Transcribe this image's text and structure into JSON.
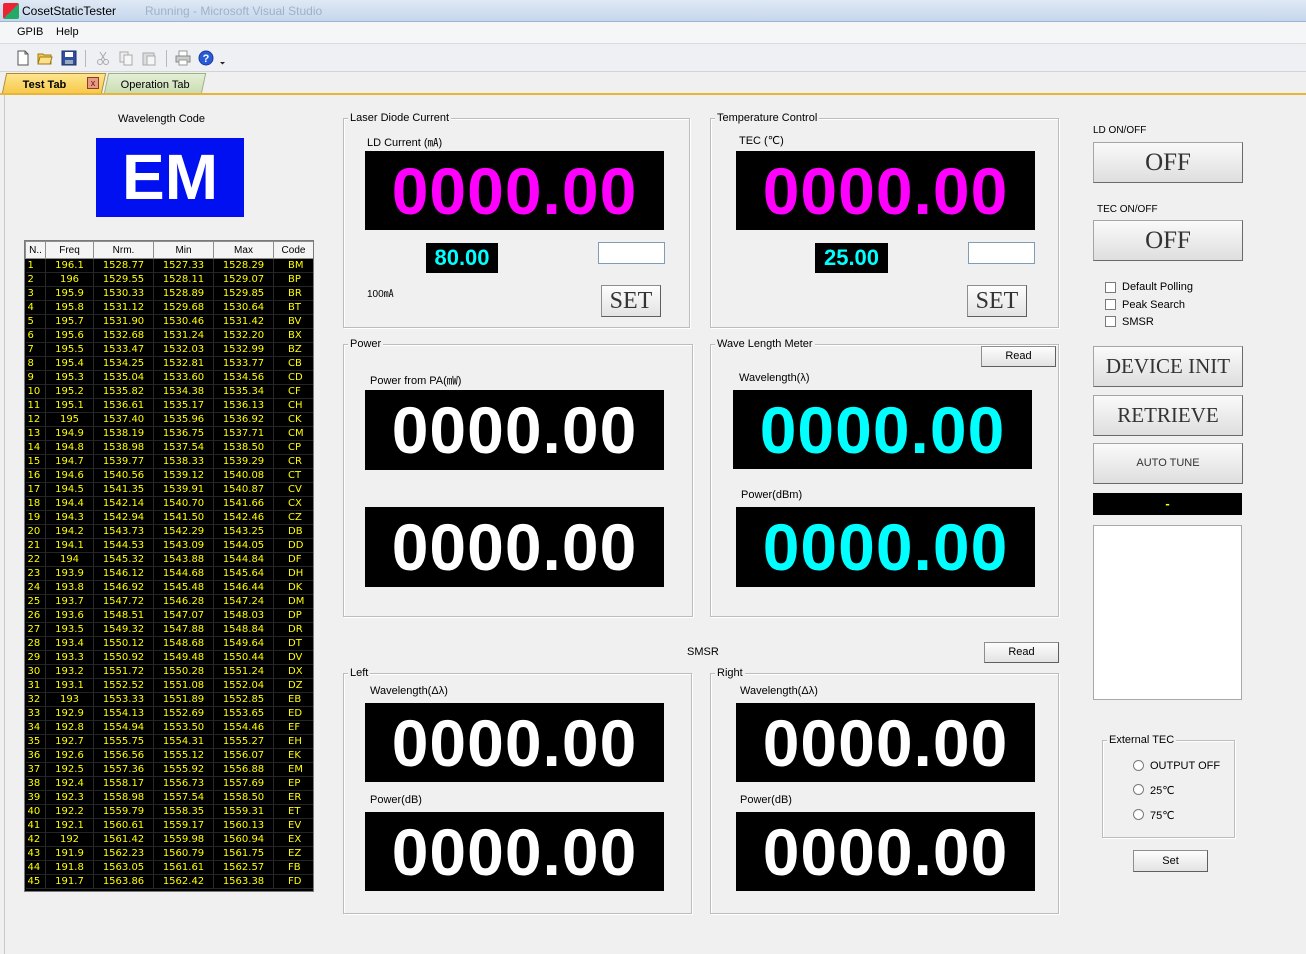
{
  "window": {
    "title": "CosetStaticTester",
    "background_title": "Running - Microsoft Visual Studio"
  },
  "menu": {
    "items": [
      "GPIB",
      "Help"
    ]
  },
  "toolbar": {
    "icons": [
      "new-icon",
      "open-icon",
      "save-icon",
      "cut-icon",
      "copy-icon",
      "paste-icon",
      "print-icon",
      "help-icon"
    ]
  },
  "tabs": {
    "test": "Test Tab",
    "close": "x",
    "operation": "Operation Tab"
  },
  "wavelength_code": {
    "label": "Wavelength Code",
    "value": "EM"
  },
  "code_table": {
    "headers": [
      "N..",
      "Freq",
      "Nrm.",
      "Min",
      "Max",
      "Code"
    ],
    "rows": [
      [
        "1",
        "196.1",
        "1528.77",
        "1527.33",
        "1528.29",
        "BM"
      ],
      [
        "2",
        "196",
        "1529.55",
        "1528.11",
        "1529.07",
        "BP"
      ],
      [
        "3",
        "195.9",
        "1530.33",
        "1528.89",
        "1529.85",
        "BR"
      ],
      [
        "4",
        "195.8",
        "1531.12",
        "1529.68",
        "1530.64",
        "BT"
      ],
      [
        "5",
        "195.7",
        "1531.90",
        "1530.46",
        "1531.42",
        "BV"
      ],
      [
        "6",
        "195.6",
        "1532.68",
        "1531.24",
        "1532.20",
        "BX"
      ],
      [
        "7",
        "195.5",
        "1533.47",
        "1532.03",
        "1532.99",
        "BZ"
      ],
      [
        "8",
        "195.4",
        "1534.25",
        "1532.81",
        "1533.77",
        "CB"
      ],
      [
        "9",
        "195.3",
        "1535.04",
        "1533.60",
        "1534.56",
        "CD"
      ],
      [
        "10",
        "195.2",
        "1535.82",
        "1534.38",
        "1535.34",
        "CF"
      ],
      [
        "11",
        "195.1",
        "1536.61",
        "1535.17",
        "1536.13",
        "CH"
      ],
      [
        "12",
        "195",
        "1537.40",
        "1535.96",
        "1536.92",
        "CK"
      ],
      [
        "13",
        "194.9",
        "1538.19",
        "1536.75",
        "1537.71",
        "CM"
      ],
      [
        "14",
        "194.8",
        "1538.98",
        "1537.54",
        "1538.50",
        "CP"
      ],
      [
        "15",
        "194.7",
        "1539.77",
        "1538.33",
        "1539.29",
        "CR"
      ],
      [
        "16",
        "194.6",
        "1540.56",
        "1539.12",
        "1540.08",
        "CT"
      ],
      [
        "17",
        "194.5",
        "1541.35",
        "1539.91",
        "1540.87",
        "CV"
      ],
      [
        "18",
        "194.4",
        "1542.14",
        "1540.70",
        "1541.66",
        "CX"
      ],
      [
        "19",
        "194.3",
        "1542.94",
        "1541.50",
        "1542.46",
        "CZ"
      ],
      [
        "20",
        "194.2",
        "1543.73",
        "1542.29",
        "1543.25",
        "DB"
      ],
      [
        "21",
        "194.1",
        "1544.53",
        "1543.09",
        "1544.05",
        "DD"
      ],
      [
        "22",
        "194",
        "1545.32",
        "1543.88",
        "1544.84",
        "DF"
      ],
      [
        "23",
        "193.9",
        "1546.12",
        "1544.68",
        "1545.64",
        "DH"
      ],
      [
        "24",
        "193.8",
        "1546.92",
        "1545.48",
        "1546.44",
        "DK"
      ],
      [
        "25",
        "193.7",
        "1547.72",
        "1546.28",
        "1547.24",
        "DM"
      ],
      [
        "26",
        "193.6",
        "1548.51",
        "1547.07",
        "1548.03",
        "DP"
      ],
      [
        "27",
        "193.5",
        "1549.32",
        "1547.88",
        "1548.84",
        "DR"
      ],
      [
        "28",
        "193.4",
        "1550.12",
        "1548.68",
        "1549.64",
        "DT"
      ],
      [
        "29",
        "193.3",
        "1550.92",
        "1549.48",
        "1550.44",
        "DV"
      ],
      [
        "30",
        "193.2",
        "1551.72",
        "1550.28",
        "1551.24",
        "DX"
      ],
      [
        "31",
        "193.1",
        "1552.52",
        "1551.08",
        "1552.04",
        "DZ"
      ],
      [
        "32",
        "193",
        "1553.33",
        "1551.89",
        "1552.85",
        "EB"
      ],
      [
        "33",
        "192.9",
        "1554.13",
        "1552.69",
        "1553.65",
        "ED"
      ],
      [
        "34",
        "192.8",
        "1554.94",
        "1553.50",
        "1554.46",
        "EF"
      ],
      [
        "35",
        "192.7",
        "1555.75",
        "1554.31",
        "1555.27",
        "EH"
      ],
      [
        "36",
        "192.6",
        "1556.56",
        "1555.12",
        "1556.07",
        "EK"
      ],
      [
        "37",
        "192.5",
        "1557.36",
        "1555.92",
        "1556.88",
        "EM"
      ],
      [
        "38",
        "192.4",
        "1558.17",
        "1556.73",
        "1557.69",
        "EP"
      ],
      [
        "39",
        "192.3",
        "1558.98",
        "1557.54",
        "1558.50",
        "ER"
      ],
      [
        "40",
        "192.2",
        "1559.79",
        "1558.35",
        "1559.31",
        "ET"
      ],
      [
        "41",
        "192.1",
        "1560.61",
        "1559.17",
        "1560.13",
        "EV"
      ],
      [
        "42",
        "192",
        "1561.42",
        "1559.98",
        "1560.94",
        "EX"
      ],
      [
        "43",
        "191.9",
        "1562.23",
        "1560.79",
        "1561.75",
        "EZ"
      ],
      [
        "44",
        "191.8",
        "1563.05",
        "1561.61",
        "1562.57",
        "FB"
      ],
      [
        "45",
        "191.7",
        "1563.86",
        "1562.42",
        "1563.38",
        "FD"
      ]
    ]
  },
  "laser_diode": {
    "title": "Laser Diode Current",
    "label": "LD Current (㎃)",
    "display": "0000.00",
    "setpoint": "80.00",
    "limit": "100㎃",
    "input": "",
    "set_label": "SET"
  },
  "temperature": {
    "title": "Temperature Control",
    "label": "TEC (℃)",
    "display": "0000.00",
    "setpoint": "25.00",
    "input": "",
    "set_label": "SET"
  },
  "power": {
    "title": "Power",
    "label": "Power from PA(㎽)",
    "display1": "0000.00",
    "display2": "0000.00"
  },
  "wave_meter": {
    "title": "Wave Length Meter",
    "read_label": "Read",
    "wavelength_label": "Wavelength(λ)",
    "wavelength": "0000.00",
    "power_label": "Power(dBm)",
    "power": "0000.00"
  },
  "smsr": {
    "title": "SMSR",
    "read_label": "Read",
    "left": {
      "title": "Left",
      "wavelength_label": "Wavelength(Δλ)",
      "wavelength": "0000.00",
      "power_label": "Power(dB)",
      "power": "0000.00"
    },
    "right": {
      "title": "Right",
      "wavelength_label": "Wavelength(Δλ)",
      "wavelength": "0000.00",
      "power_label": "Power(dB)",
      "power": "0000.00"
    }
  },
  "controls": {
    "ld_onoff_label": "LD ON/OFF",
    "ld_onoff": "OFF",
    "tec_onoff_label": "TEC ON/OFF",
    "tec_onoff": "OFF",
    "default_polling": "Default Polling",
    "peak_search": "Peak Search",
    "smsr": "SMSR",
    "device_init": "DEVICE INIT",
    "retrieve": "RETRIEVE",
    "auto_tune": "AUTO TUNE",
    "status": "-",
    "log": ""
  },
  "external_tec": {
    "title": "External TEC",
    "options": [
      "OUTPUT OFF",
      "25℃",
      "75℃"
    ],
    "set_label": "Set"
  },
  "colors": {
    "display_bg": "#000000",
    "magenta": "#ff00ff",
    "cyan": "#00ffff",
    "table_text": "#ffff00",
    "code_bg": "#0010f0"
  }
}
